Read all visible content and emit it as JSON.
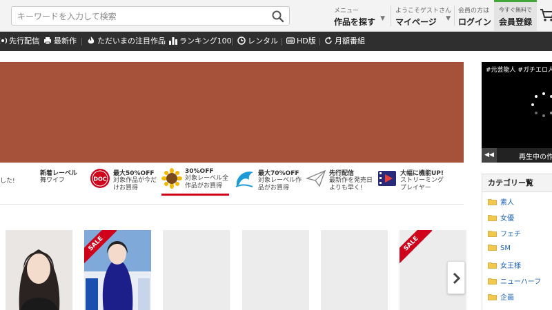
{
  "search": {
    "placeholder": "キーワードを入力して検索"
  },
  "header_nav": [
    {
      "small": "メニュー",
      "big": "作品を探す"
    },
    {
      "small": "ようこそゲストさん",
      "big": "マイページ"
    },
    {
      "small": "会員の方は",
      "big": "ログイン"
    }
  ],
  "register": {
    "small": "今すぐ無料で",
    "big": "会員登録"
  },
  "dark_nav": [
    {
      "label": "先行配信",
      "icon": "broadcast-icon"
    },
    {
      "label": "最新作",
      "icon": "printer-icon"
    },
    {
      "label": "ただいまの注目作品",
      "icon": "flame-icon"
    },
    {
      "label": "ランキング100",
      "icon": "bar-chart-icon"
    },
    {
      "label": "レンタル",
      "icon": "clock-icon"
    },
    {
      "label": "HD版",
      "icon": "hd-icon"
    },
    {
      "label": "月額番組",
      "icon": "refresh-icon"
    }
  ],
  "promos": [
    {
      "title": "",
      "line1": "した!",
      "line2": ""
    },
    {
      "title": "新着レーベル",
      "line1": "舞ワイフ",
      "line2": ""
    },
    {
      "title": "最大50%OFF",
      "line1": "対象作品が今だ",
      "line2": "けお買得"
    },
    {
      "title": "30%OFF",
      "line1": "対象レーベル全",
      "line2": "作品がお買得"
    },
    {
      "title": "最大70%OFF",
      "line1": "対象レーベル作",
      "line2": "品がお買得"
    },
    {
      "title": "先行配信",
      "line1": "最新作を発売日",
      "line2": "よりも早く!"
    },
    {
      "title": "大幅に機能UP!",
      "line1": "ストリーミング",
      "line2": "プレイヤー"
    }
  ],
  "products": [
    {
      "ribbon": ""
    },
    {
      "ribbon": "SALE"
    },
    {
      "ribbon": ""
    },
    {
      "ribbon": ""
    },
    {
      "ribbon": ""
    },
    {
      "ribbon": "SALE"
    }
  ],
  "player": {
    "tags": "#元芸能人 #ガチエロ人",
    "prev_label": "◀◀",
    "playing_label": "再生中の作"
  },
  "categories": {
    "title": "カテゴリー覧",
    "items": [
      "素人",
      "女優",
      "フェチ",
      "SM",
      "女王様",
      "ニューハーフ",
      "企画"
    ]
  },
  "colors": {
    "banner": "#a6523a",
    "accent_red": "#d0021b",
    "register_green": "#42a63b",
    "nav_dark": "#2f2f2f",
    "link_blue": "#1a5fb4"
  }
}
